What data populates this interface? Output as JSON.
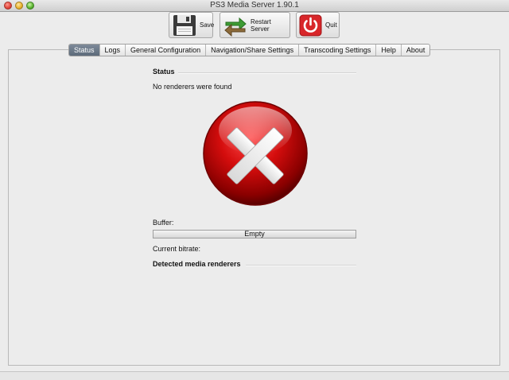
{
  "window": {
    "title": "PS3 Media Server 1.90.1"
  },
  "toolbar": {
    "save_label": "Save",
    "restart_label": "Restart Server",
    "quit_label": "Quit"
  },
  "tabs": [
    {
      "label": "Status",
      "active": true
    },
    {
      "label": "Logs"
    },
    {
      "label": "General Configuration"
    },
    {
      "label": "Navigation/Share Settings"
    },
    {
      "label": "Transcoding Settings"
    },
    {
      "label": "Help"
    },
    {
      "label": "About"
    }
  ],
  "status": {
    "heading": "Status",
    "message": "No renderers were found",
    "icon": "error-x-icon",
    "buffer_label": "Buffer:",
    "buffer_value": "Empty",
    "bitrate_label": "Current bitrate:",
    "renderers_heading": "Detected media renderers"
  },
  "colors": {
    "error_red": "#d40d0d",
    "active_tab": "#6b7888"
  }
}
